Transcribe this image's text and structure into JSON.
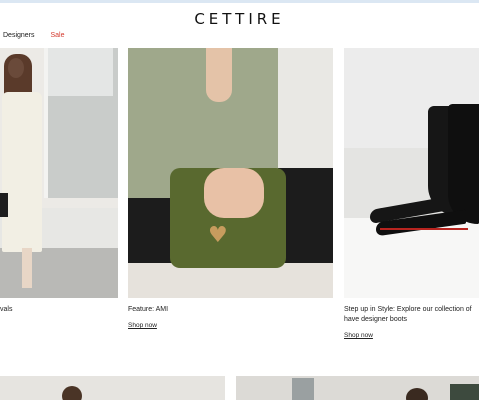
{
  "header": {
    "logo": "CETTIRE",
    "nav": [
      {
        "label": "Designers"
      },
      {
        "label": "Sale",
        "color": "#d43a2f"
      }
    ]
  },
  "cards": [
    {
      "caption": "vals",
      "link": ""
    },
    {
      "caption": "Feature: AMI",
      "link": "Shop now"
    },
    {
      "caption": "Step up in Style: Explore our collection of",
      "caption2": "have designer boots",
      "link": "Shop now"
    }
  ]
}
